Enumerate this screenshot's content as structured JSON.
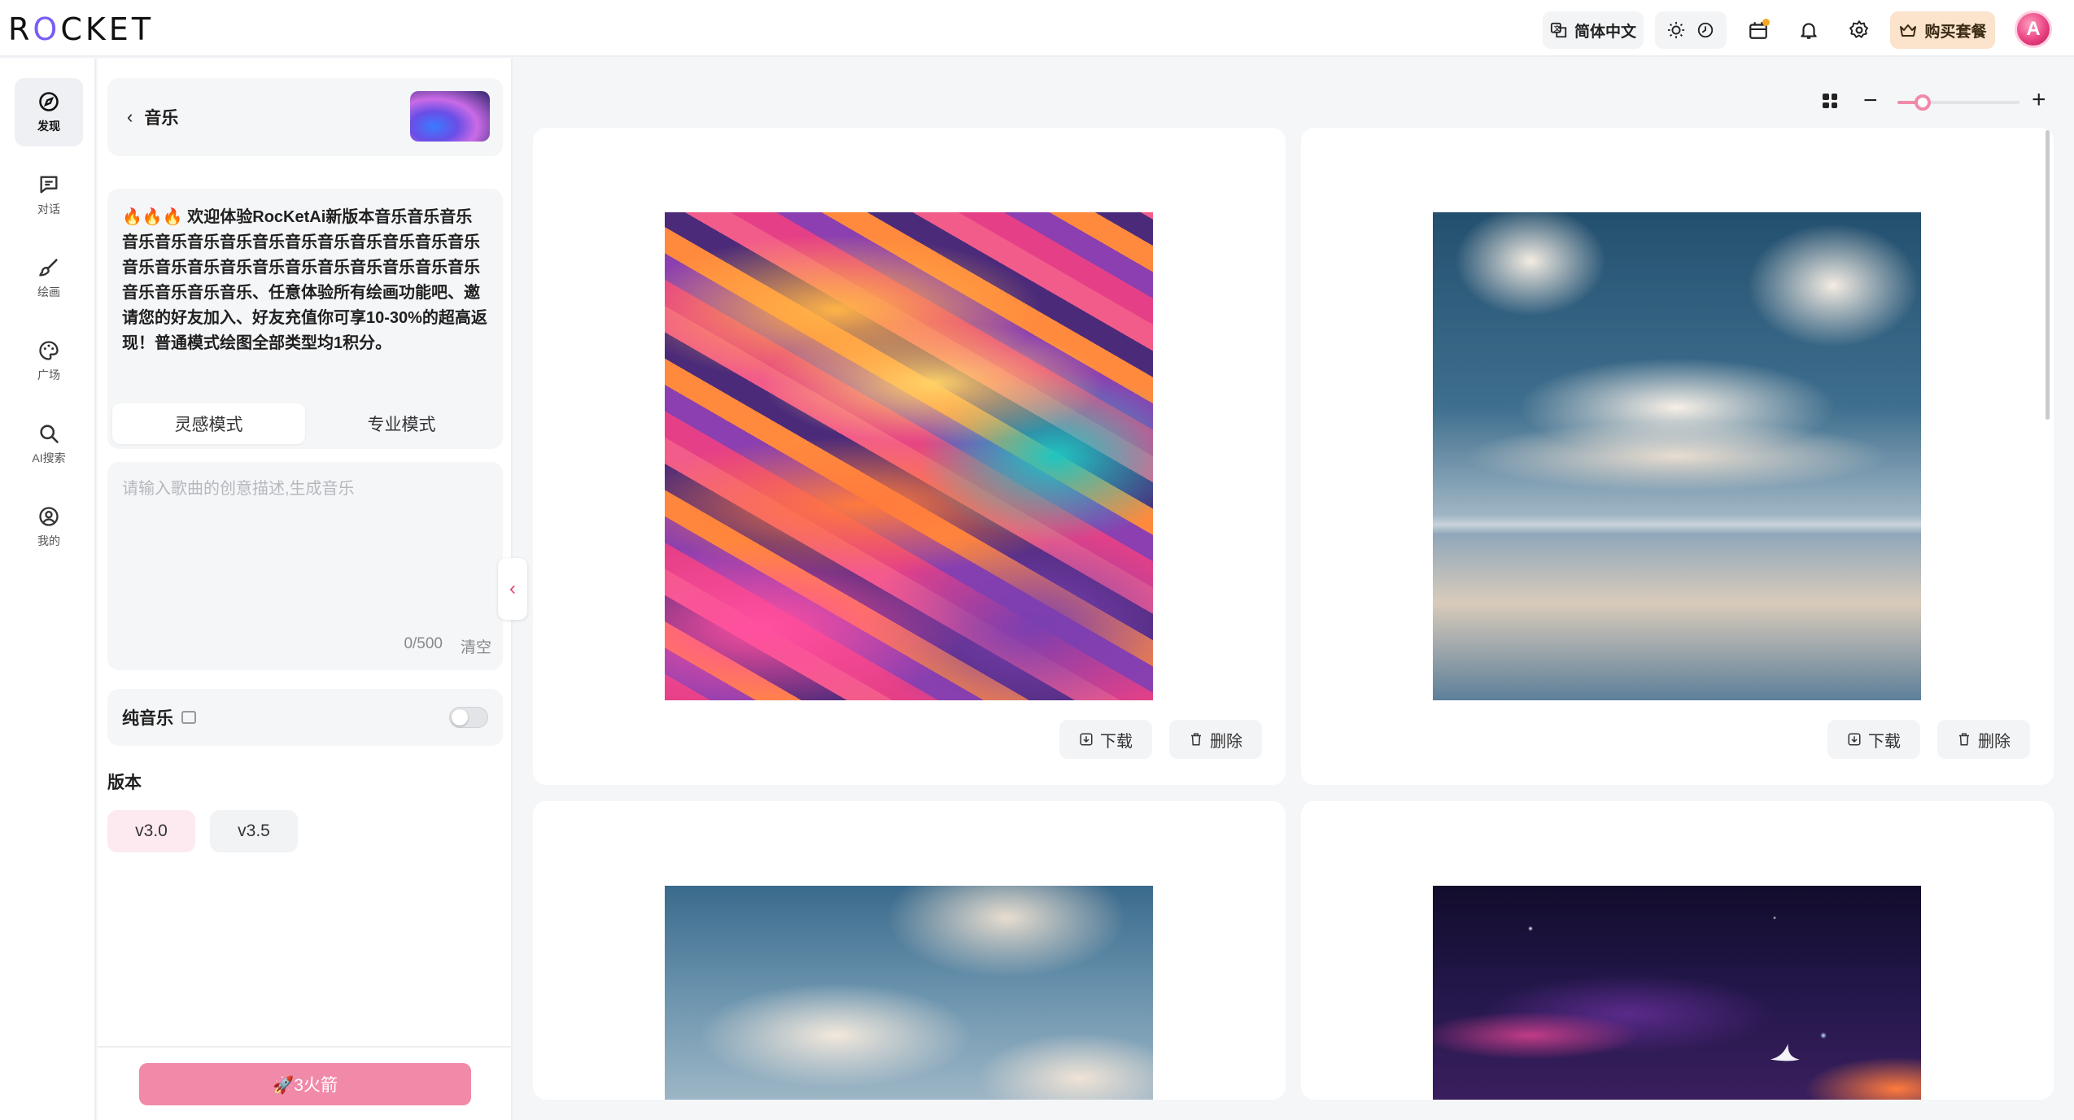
{
  "header": {
    "logo": "ROCKET",
    "language_label": "简体中文",
    "buy_label": "购买套餐",
    "avatar_letter": "A"
  },
  "rail": {
    "items": [
      {
        "label": "发现",
        "icon": "compass-icon",
        "active": true
      },
      {
        "label": "对话",
        "icon": "chat-icon",
        "active": false
      },
      {
        "label": "绘画",
        "icon": "brush-icon",
        "active": false
      },
      {
        "label": "广场",
        "icon": "palette-icon",
        "active": false
      },
      {
        "label": "AI搜索",
        "icon": "search-icon",
        "active": false
      },
      {
        "label": "我的",
        "icon": "user-circle-icon",
        "active": false
      }
    ]
  },
  "panel": {
    "title": "音乐",
    "notice": "🔥🔥🔥 欢迎体验RocKetAi新版本音乐音乐音乐音乐音乐音乐音乐音乐音乐音乐音乐音乐音乐音乐音乐音乐音乐音乐音乐音乐音乐音乐音乐音乐音乐音乐音乐音乐音乐、任意体验所有绘画功能吧、邀请您的好友加入、好友充值你可享10-30%的超高返现！普通模式绘图全部类型均1积分。",
    "tabs": [
      {
        "label": "灵感模式",
        "active": true
      },
      {
        "label": "专业模式",
        "active": false
      }
    ],
    "prompt_placeholder": "请输入歌曲的创意描述,生成音乐",
    "char_count": "0/500",
    "clear_label": "清空",
    "pure_music_label": "纯音乐",
    "pure_music_on": false,
    "version_title": "版本",
    "versions": [
      {
        "label": "v3.0",
        "selected": true
      },
      {
        "label": "v3.5",
        "selected": false
      }
    ],
    "submit_label": "🚀3火箭"
  },
  "toolbar": {
    "zoom_level": 0.18
  },
  "gallery": {
    "download_label": "下载",
    "delete_label": "删除",
    "items": [
      {
        "art": "colorful-fluid-swirl"
      },
      {
        "art": "clouds-reflection"
      },
      {
        "art": "clouds-sky"
      },
      {
        "art": "space-nebula-bird"
      }
    ]
  },
  "colors": {
    "accent": "#f08aa8",
    "accent_light": "#fdeaf0",
    "buy_bg": "#fbe3cc"
  }
}
